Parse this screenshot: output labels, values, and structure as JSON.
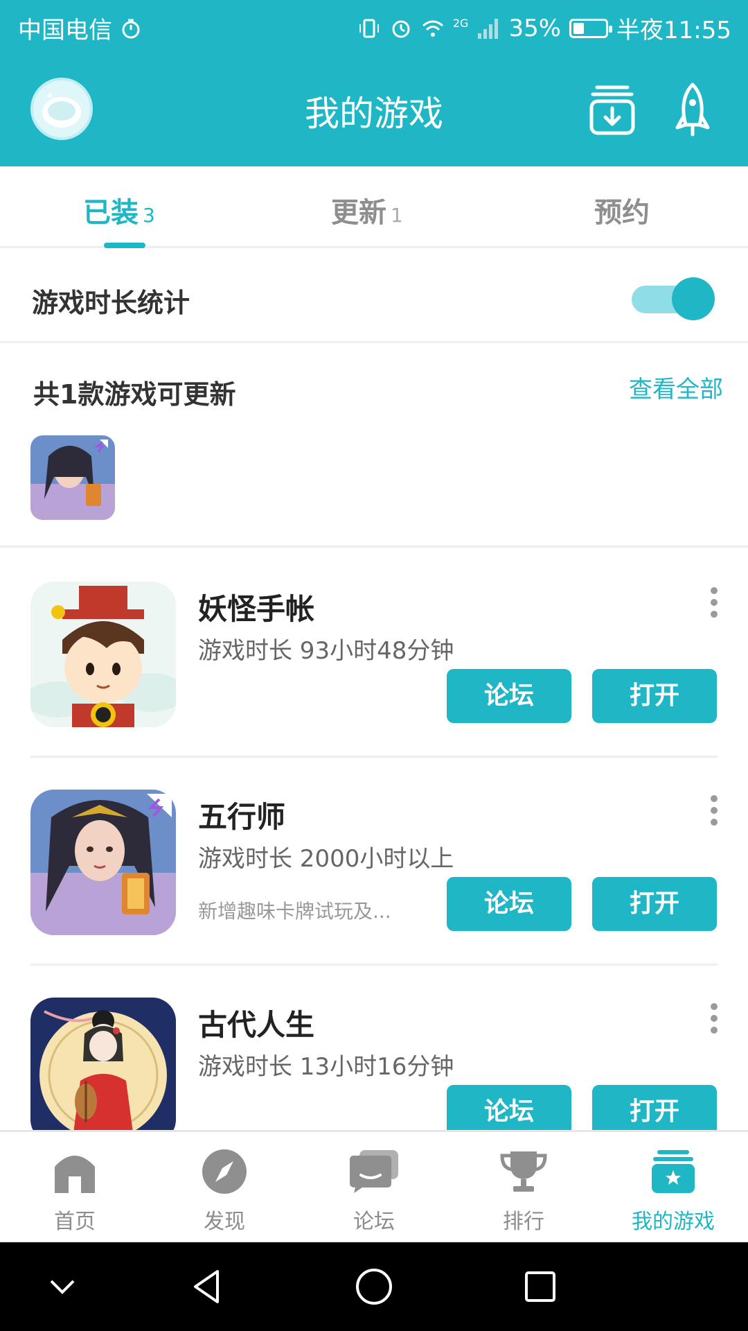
{
  "status_bar": {
    "carrier": "中国电信",
    "network": "2G",
    "battery": "35%",
    "battery_level": 0.35,
    "time": "半夜11:55"
  },
  "header": {
    "title": "我的游戏",
    "download_icon": "download-box-icon",
    "rocket_icon": "rocket-icon"
  },
  "tabs": [
    {
      "label": "已装",
      "count": "3"
    },
    {
      "label": "更新",
      "count": "1"
    },
    {
      "label": "预约",
      "count": ""
    }
  ],
  "stats": {
    "label": "游戏时长统计",
    "enabled": true
  },
  "update_section": {
    "title": "共1款游戏可更新",
    "view_all": "查看全部"
  },
  "games": [
    {
      "name": "妖怪手帐",
      "playtime": "游戏时长 93小时48分钟",
      "note": "",
      "forum_label": "论坛",
      "open_label": "打开"
    },
    {
      "name": "五行师",
      "playtime": "游戏时长 2000小时以上",
      "note": "新增趣味卡牌试玩及...",
      "forum_label": "论坛",
      "open_label": "打开"
    },
    {
      "name": "古代人生",
      "playtime": "游戏时长 13小时16分钟",
      "note": "",
      "forum_label": "论坛",
      "open_label": "打开"
    }
  ],
  "bottom_nav": [
    {
      "label": "首页",
      "icon": "home-icon"
    },
    {
      "label": "发现",
      "icon": "compass-icon"
    },
    {
      "label": "论坛",
      "icon": "chat-bubbles-icon"
    },
    {
      "label": "排行",
      "icon": "trophy-icon"
    },
    {
      "label": "我的游戏",
      "icon": "game-stack-icon",
      "active": true
    }
  ],
  "colors": {
    "accent": "#1fb6c6",
    "toggle_track": "#8fdde6",
    "inactive_text": "#8c8c8c"
  }
}
